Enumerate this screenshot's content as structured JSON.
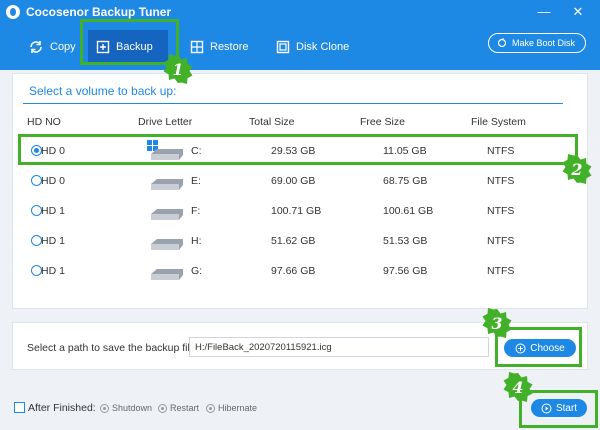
{
  "window": {
    "title": "Cocosenor Backup Tuner",
    "minimize": "—",
    "close": "✕"
  },
  "toolbar": {
    "copy": "Copy",
    "backup": "Backup",
    "restore": "Restore",
    "disk_clone": "Disk Clone",
    "make_boot_disk": "Make Boot Disk"
  },
  "volumes": {
    "heading": "Select a volume to back up:",
    "columns": [
      "HD NO",
      "Drive Letter",
      "Total Size",
      "Free Size",
      "File System"
    ],
    "rows": [
      {
        "hd": "HD 0",
        "letter": "C:",
        "total": "29.53 GB",
        "free": "11.05 GB",
        "fs": "NTFS",
        "selected": true,
        "system": true
      },
      {
        "hd": "HD 0",
        "letter": "E:",
        "total": "69.00 GB",
        "free": "68.75 GB",
        "fs": "NTFS",
        "selected": false,
        "system": false
      },
      {
        "hd": "HD 1",
        "letter": "F:",
        "total": "100.71 GB",
        "free": "100.61 GB",
        "fs": "NTFS",
        "selected": false,
        "system": false
      },
      {
        "hd": "HD 1",
        "letter": "H:",
        "total": "51.62 GB",
        "free": "51.53 GB",
        "fs": "NTFS",
        "selected": false,
        "system": false
      },
      {
        "hd": "HD 1",
        "letter": "G:",
        "total": "97.66 GB",
        "free": "97.56 GB",
        "fs": "NTFS",
        "selected": false,
        "system": false
      }
    ]
  },
  "path": {
    "label": "Select a path to save the backup file:",
    "value": "H:/FileBack_2020720115921.icg",
    "choose": "Choose"
  },
  "after": {
    "label": "After Finished:",
    "options": [
      "Shutdown",
      "Restart",
      "Hibernate"
    ]
  },
  "start": "Start",
  "steps": [
    "1",
    "2",
    "3",
    "4"
  ],
  "colors": {
    "accent": "#1e88e5",
    "highlight": "#43b02a"
  }
}
